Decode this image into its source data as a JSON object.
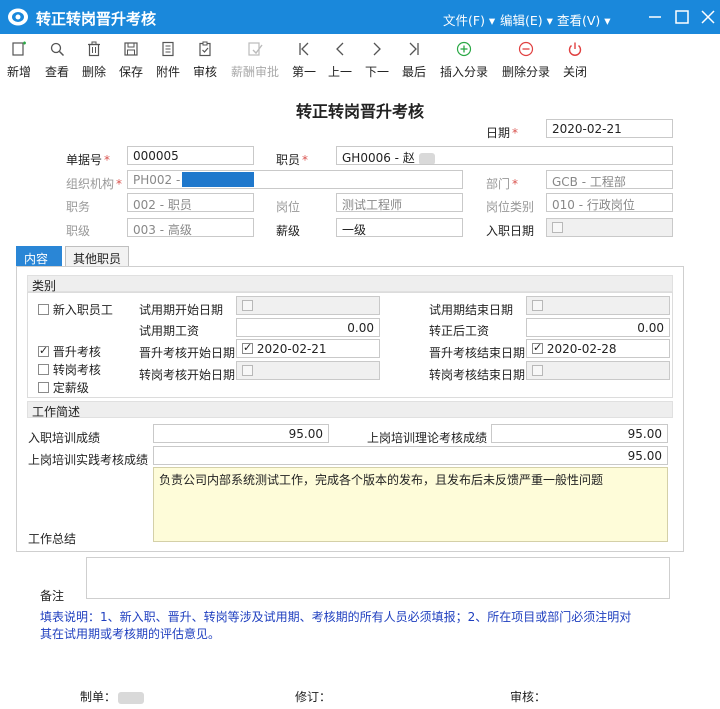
{
  "window": {
    "title": "转正转岗晋升考核",
    "menus": [
      "文件(F)",
      "编辑(E)",
      "查看(V)"
    ]
  },
  "toolbar": {
    "items": [
      {
        "label": "新增",
        "icon": "new-doc-icon"
      },
      {
        "label": "查看",
        "icon": "view-icon"
      },
      {
        "label": "删除",
        "icon": "trash-icon"
      },
      {
        "label": "保存",
        "icon": "save-icon"
      },
      {
        "label": "附件",
        "icon": "attachment-icon"
      },
      {
        "label": "审核",
        "icon": "audit-icon"
      },
      {
        "label": "薪酬审批",
        "icon": "approve-icon",
        "disabled": true
      },
      {
        "label": "第一",
        "icon": "first-icon"
      },
      {
        "label": "上一",
        "icon": "prev-icon"
      },
      {
        "label": "下一",
        "icon": "next-icon"
      },
      {
        "label": "最后",
        "icon": "last-icon"
      },
      {
        "label": "插入分录",
        "icon": "insert-row-icon"
      },
      {
        "label": "删除分录",
        "icon": "delete-row-icon"
      },
      {
        "label": "关闭",
        "icon": "power-icon"
      }
    ]
  },
  "header": {
    "doc_title": "转正转岗晋升考核",
    "date_label": "日期",
    "date_value": "2020-02-21",
    "bill_no_label": "单据号",
    "bill_no_value": "000005",
    "employee_label": "职员",
    "employee_value": "GH0006 - 赵",
    "org_label": "组织机构",
    "org_value": "PH002 -",
    "dept_label": "部门",
    "dept_value": "GCB - 工程部",
    "duty_label": "职务",
    "duty_value": "002 - 职员",
    "post_label": "岗位",
    "post_value": "测试工程师",
    "post_type_label": "岗位类别",
    "post_type_value": "010 - 行政岗位",
    "grade_label": "职级",
    "grade_value": "003 - 高级",
    "salary_grade_label": "薪级",
    "salary_grade_value": "一级",
    "entry_date_label": "入职日期"
  },
  "tabs": [
    "内容",
    "其他职员"
  ],
  "category": {
    "section_label": "类别",
    "options": [
      {
        "label": "新入职员工",
        "checked": false
      },
      {
        "label": "晋升考核",
        "checked": true
      },
      {
        "label": "转岗考核",
        "checked": false
      },
      {
        "label": "定薪级",
        "checked": false
      }
    ],
    "probation_start_label": "试用期开始日期",
    "probation_end_label": "试用期结束日期",
    "probation_salary_label": "试用期工资",
    "probation_salary_value": "0.00",
    "regular_salary_label": "转正后工资",
    "regular_salary_value": "0.00",
    "promo_start_label": "晋升考核开始日期",
    "promo_start_value": "2020-02-21",
    "promo_end_label": "晋升考核结束日期",
    "promo_end_value": "2020-02-28",
    "transfer_start_label": "转岗考核开始日期",
    "transfer_end_label": "转岗考核结束日期"
  },
  "work": {
    "section_label": "工作简述",
    "entry_training_label": "入职培训成绩",
    "entry_training_value": "95.00",
    "theory_label": "上岗培训理论考核成绩",
    "theory_value": "95.00",
    "practice_label": "上岗培训实践考核成绩",
    "practice_value": "95.00",
    "summary_label": "工作总结",
    "summary_value": "负责公司内部系统测试工作，完成各个版本的发布，且发布后未反馈严重一般性问题"
  },
  "remark": {
    "label": "备注",
    "note_line1": "填表说明：1、新入职、晋升、转岗等涉及试用期、考核期的所有人员必须填报；2、所在项目或部门必须注明对",
    "note_line2": "其在试用期或考核期的评估意见。"
  },
  "footer": {
    "maker_label": "制单：",
    "revise_label": "修订：",
    "audit_label": "审核："
  },
  "colors": {
    "titlebar": "#1a88db",
    "tab_active": "#2a86d6",
    "required": "#d9534f",
    "note": "#1f3fbf",
    "summary_bg": "#fefcd9"
  }
}
